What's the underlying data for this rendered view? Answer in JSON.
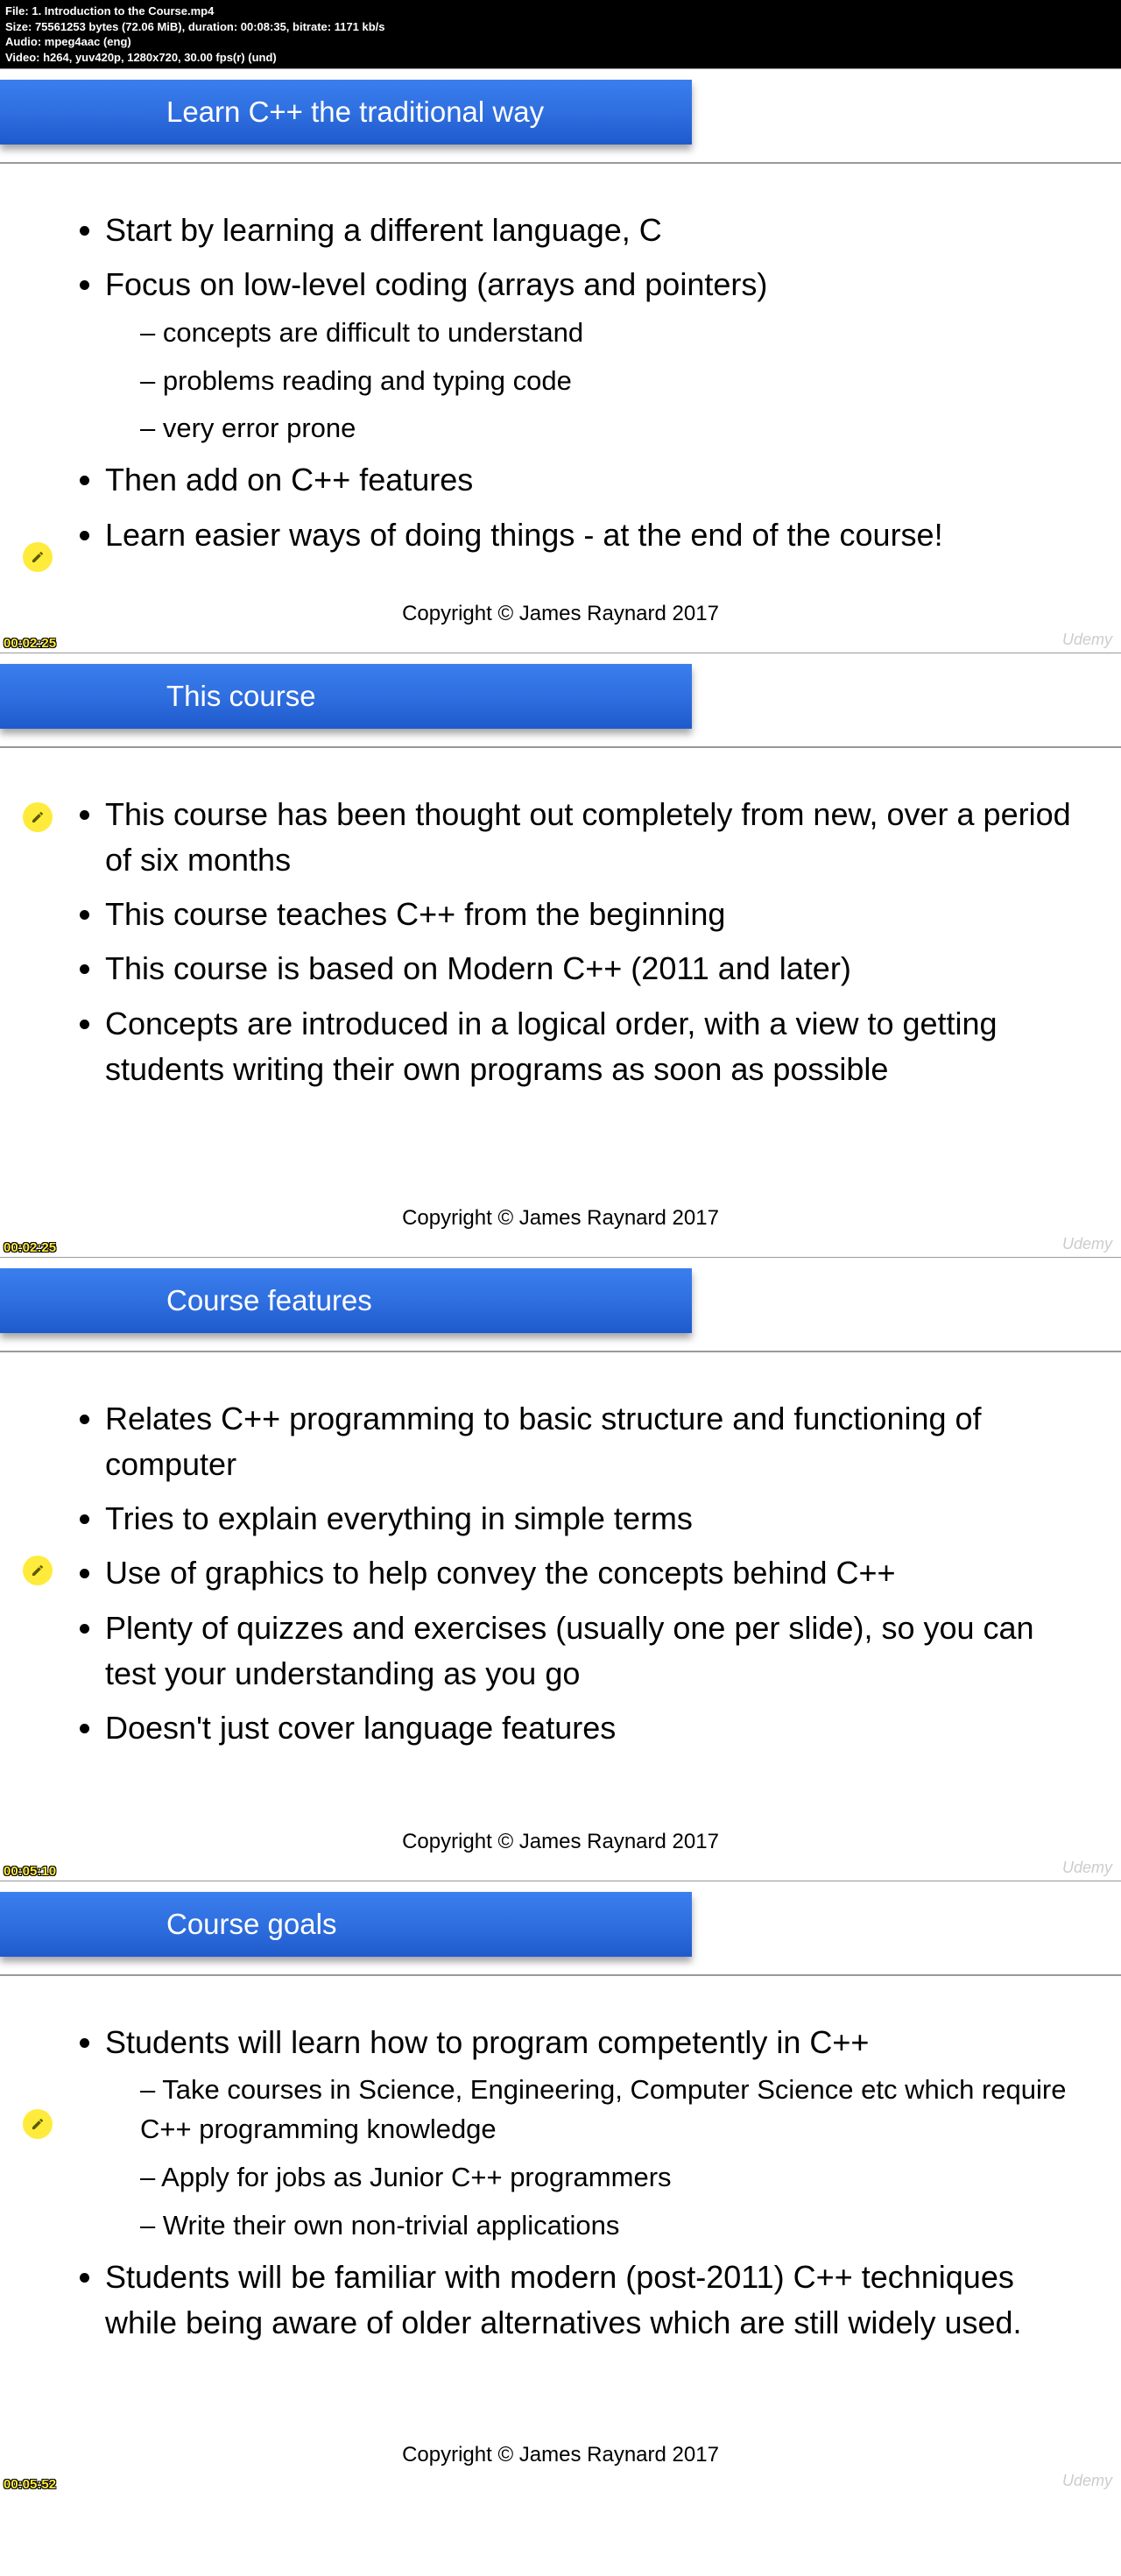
{
  "meta": {
    "line1": "File: 1. Introduction to the Course.mp4",
    "line2": "Size: 75561253 bytes (72.06 MiB), duration: 00:08:35, bitrate: 1171 kb/s",
    "line3": "Audio: mpeg4aac (eng)",
    "line4": "Video: h264, yuv420p, 1280x720, 30.00 fps(r) (und)"
  },
  "copyright": "Copyright © James Raynard 2017",
  "watermark": "Udemy",
  "slides": {
    "s1": {
      "title": "Learn C++ the traditional way",
      "b1": "Start by learning a different language, C",
      "b2": "Focus on low-level coding (arrays and pointers)",
      "b2a": "concepts are difficult to understand",
      "b2b": "problems reading and typing code",
      "b2c": "very error prone",
      "b3": "Then add on C++ features",
      "b4": "Learn easier ways of doing things - at the end of the course!",
      "ts": "00:02:25"
    },
    "s2": {
      "title": "This course",
      "b1": "This course has been thought out completely from new, over a period of six months",
      "b2": "This course teaches C++ from the beginning",
      "b3": "This course is based on Modern C++ (2011 and later)",
      "b4": "Concepts are introduced in a logical order, with a view to getting students writing their own programs as soon as possible",
      "ts": "00:02:25"
    },
    "s3": {
      "title": "Course features",
      "b1": "Relates C++ programming to basic structure and functioning of computer",
      "b2": "Tries to explain everything in simple terms",
      "b3": "Use of graphics to help convey the concepts behind C++",
      "b4": "Plenty of quizzes and exercises (usually one per slide), so you can test your understanding as you go",
      "b5": "Doesn't just cover language features",
      "ts": "00:05:10"
    },
    "s4": {
      "title": "Course goals",
      "b1": "Students will learn how to program competently in C++",
      "b1a": "Take courses in Science, Engineering, Computer Science etc which require C++ programming knowledge",
      "b1b": "Apply for jobs as Junior C++ programmers",
      "b1c": "Write their own non-trivial applications",
      "b2": "Students will be familiar with modern (post-2011) C++ techniques while being aware of older alternatives which are still widely used.",
      "ts": "00:05:52"
    }
  }
}
